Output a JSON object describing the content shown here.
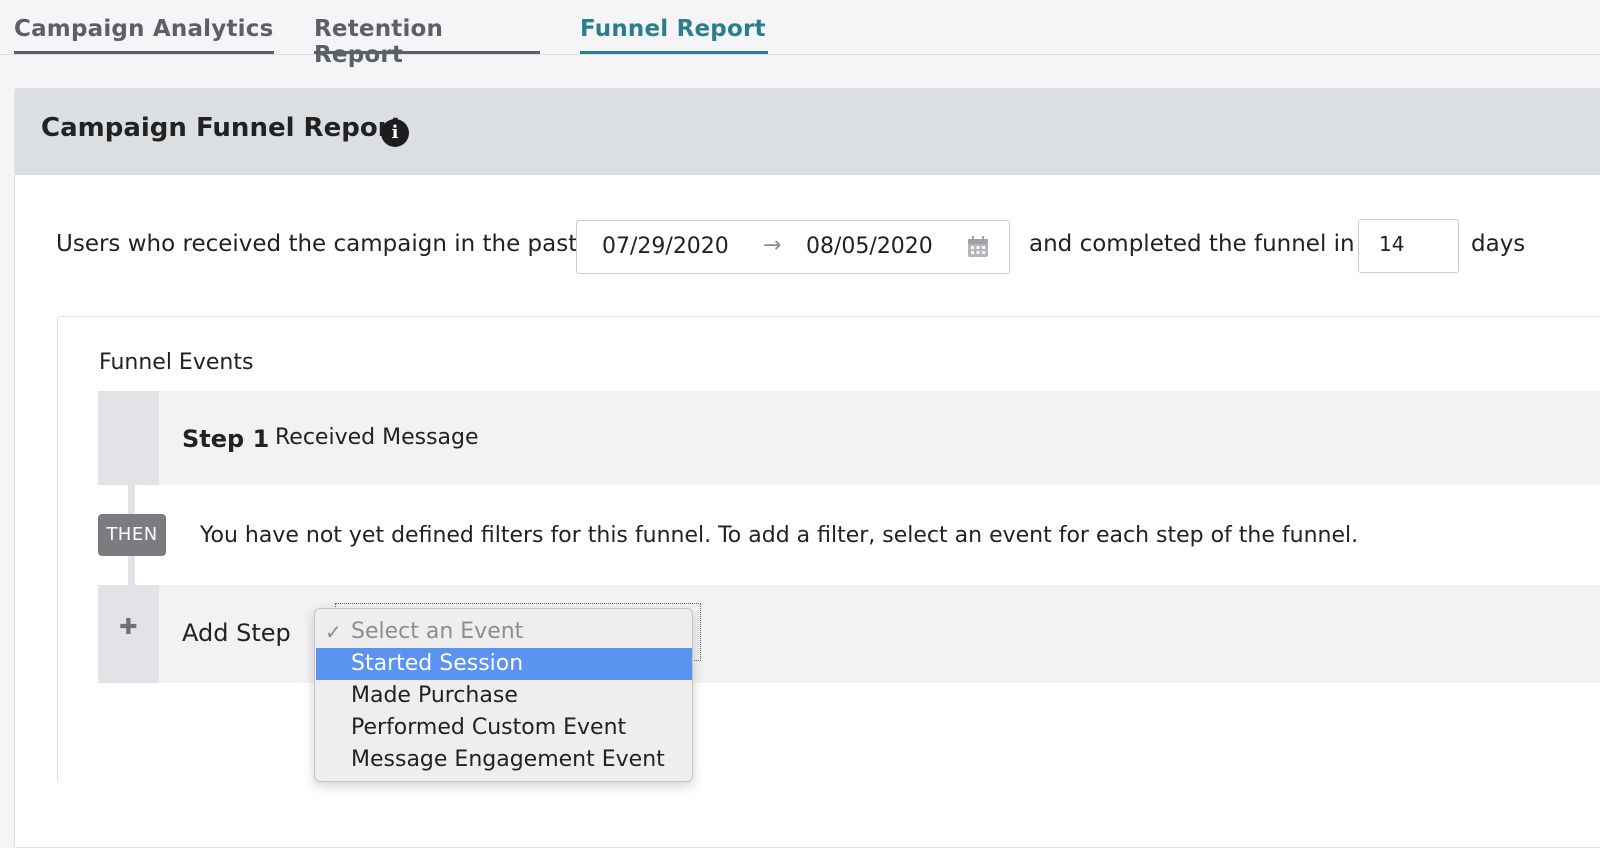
{
  "tabs": [
    {
      "label": "Campaign Analytics"
    },
    {
      "label": "Retention Report"
    },
    {
      "label": "Funnel Report",
      "active": true
    }
  ],
  "card": {
    "title": "Campaign Funnel Report",
    "info_icon": "info-icon"
  },
  "criteria": {
    "prefix": "Users who received the campaign in the past",
    "start_date": "07/29/2020",
    "end_date": "08/05/2020",
    "arrow_icon": "arrow-right-icon",
    "calendar_icon": "calendar-icon",
    "middle": "and completed the funnel in",
    "days_value": "14",
    "suffix": "days"
  },
  "funnel": {
    "label": "Funnel Events",
    "steps": [
      {
        "label": "Step 1",
        "event": "Received Message"
      }
    ],
    "then_badge": "THEN",
    "then_message": "You have not yet defined filters for this funnel. To add a filter, select an event for each step of the funnel.",
    "add_step_label": "Add Step",
    "plus_icon": "plus-icon"
  },
  "dropdown": {
    "placeholder": "Select an Event",
    "check_glyph": "✓",
    "options": [
      {
        "label": "Started Session",
        "highlighted": true
      },
      {
        "label": "Made Purchase"
      },
      {
        "label": "Performed Custom Event"
      },
      {
        "label": "Message Engagement Event"
      }
    ]
  },
  "colors": {
    "active_tab": "#2b7f8c",
    "inactive_tab": "#5b5f66",
    "highlight": "#5a93f0",
    "header_bg": "#dcdfe2",
    "then_badge": "#7a7c80"
  }
}
